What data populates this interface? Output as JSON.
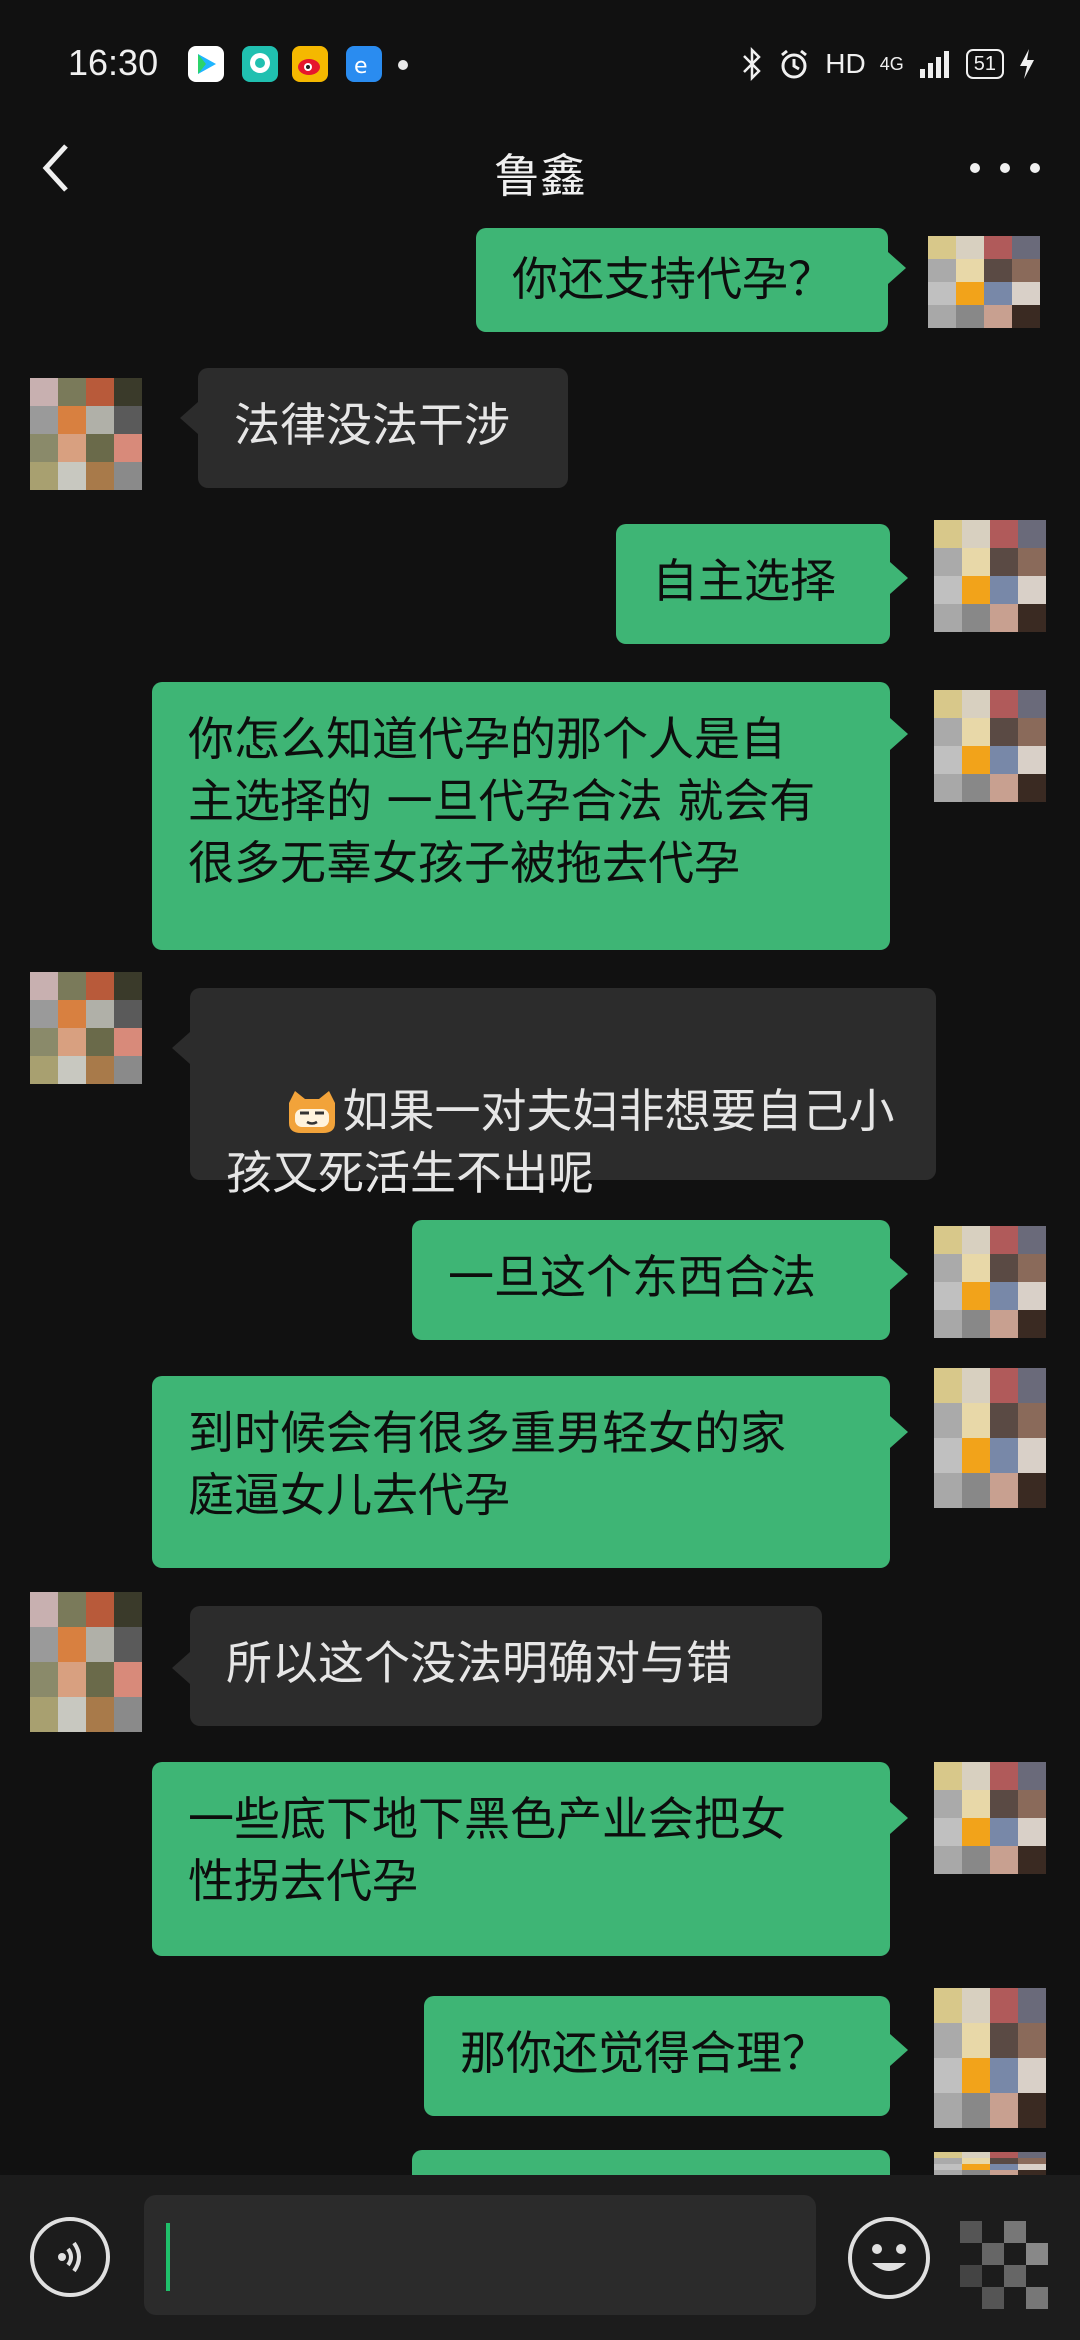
{
  "status": {
    "time": "16:30",
    "hd": "HD",
    "network": "4G",
    "battery": "51"
  },
  "header": {
    "title": "鲁鑫"
  },
  "messages": [
    {
      "side": "me",
      "text": "你还支持代孕？"
    },
    {
      "side": "them",
      "text": "法律没法干涉"
    },
    {
      "side": "me",
      "text": "自主选择"
    },
    {
      "side": "me",
      "text": "你怎么知道代孕的那个人是自\n主选择的 一旦代孕合法 就会有\n很多无辜女孩子被拖去代孕"
    },
    {
      "side": "them",
      "text": "如果一对夫妇非想要自己小\n孩又死活生不出呢",
      "emoji": "cat-face"
    },
    {
      "side": "me",
      "text": "一旦这个东西合法"
    },
    {
      "side": "me",
      "text": "到时候会有很多重男轻女的家\n庭逼女儿去代孕"
    },
    {
      "side": "them",
      "text": "所以这个没法明确对与错"
    },
    {
      "side": "me",
      "text": "一些底下地下黑色产业会把女\n性拐去代孕"
    },
    {
      "side": "me",
      "text": "那你还觉得合理？"
    }
  ],
  "colors": {
    "background": "#111111",
    "my_bubble": "#3eb575",
    "their_bubble": "#2c2c2c",
    "input_bar": "#1c1c1c"
  }
}
